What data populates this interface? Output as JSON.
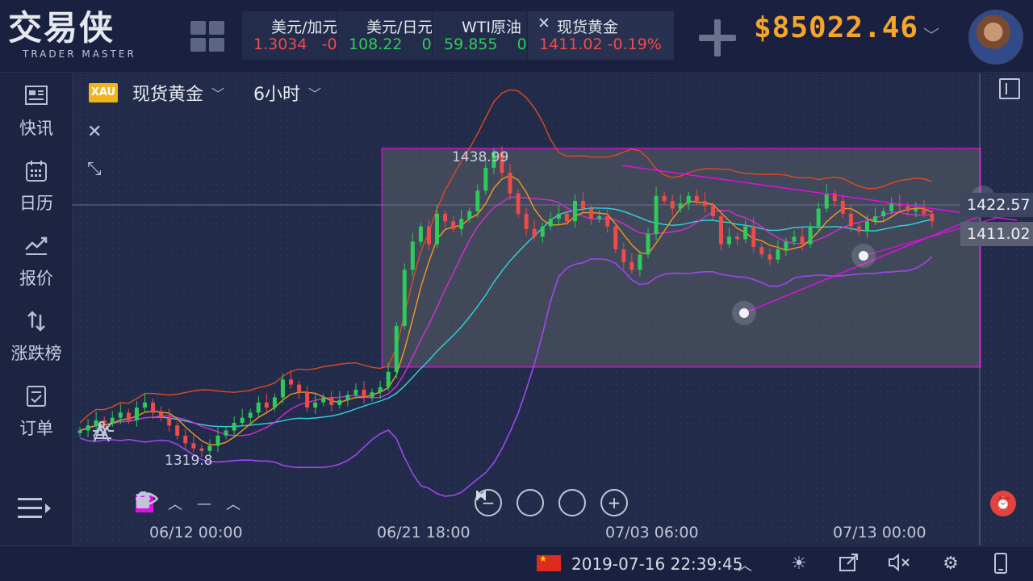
{
  "logo": {
    "cn": "交易侠",
    "en": "TRADER MASTER"
  },
  "tabs": [
    {
      "name": "美元/加元",
      "price": "1.3034",
      "change": "-0",
      "price_color": "red"
    },
    {
      "name": "美元/日元",
      "price": "108.22",
      "change": "0",
      "price_color": "green"
    },
    {
      "name": "WTI原油",
      "price": "59.855",
      "change": "0",
      "price_color": "green"
    },
    {
      "name": "现货黄金",
      "price": "1411.02",
      "change": "-0.19%",
      "price_color": "red",
      "active": true
    }
  ],
  "balance": "$85022.46",
  "sidebar": [
    {
      "label": "快讯",
      "icon": "news-icon"
    },
    {
      "label": "日历",
      "icon": "calendar-icon"
    },
    {
      "label": "报价",
      "icon": "quote-chart-icon"
    },
    {
      "label": "涨跌榜",
      "icon": "up-down-arrows-icon"
    },
    {
      "label": "订单",
      "icon": "order-icon"
    }
  ],
  "chart_header": {
    "badge": "XAU",
    "symbol": "现货黄金",
    "period": "6小时"
  },
  "price_tags": {
    "level": "1422.57",
    "current": "1411.02"
  },
  "labels": {
    "high": "1438.99",
    "low": "1319.8"
  },
  "x_axis": [
    "06/12 00:00",
    "06/21 18:00",
    "07/03 06:00",
    "07/13 00:00"
  ],
  "footer": {
    "datetime": "2019-07-16 22:39:45"
  },
  "colors": {
    "accent": "#f5a52a",
    "up": "#2fca5a",
    "down": "#ee4b4b",
    "drawing": "#e20ee2",
    "badge": "#f0b51e"
  },
  "chart_data": {
    "type": "candlestick",
    "symbol": "现货黄金",
    "period": "6小时",
    "x_ticks": [
      "06/12 00:00",
      "06/21 18:00",
      "07/03 06:00",
      "07/13 00:00"
    ],
    "high_marker": 1438.99,
    "low_marker": 1319.8,
    "current_price": 1411.02,
    "horizontal_level": 1422.57,
    "ylim": [
      1295,
      1450
    ],
    "closes": [
      1329,
      1331,
      1333,
      1332,
      1334,
      1336,
      1333,
      1338,
      1340,
      1336,
      1334,
      1331,
      1327,
      1324,
      1322,
      1321,
      1323,
      1327,
      1329,
      1332,
      1334,
      1336,
      1340,
      1338,
      1342,
      1349,
      1347,
      1344,
      1338,
      1340,
      1342,
      1339,
      1341,
      1343,
      1345,
      1342,
      1344,
      1346,
      1352,
      1370,
      1392,
      1403,
      1409,
      1402,
      1414,
      1411,
      1408,
      1412,
      1415,
      1423,
      1432,
      1438,
      1430,
      1422,
      1414,
      1408,
      1405,
      1409,
      1412,
      1414,
      1411,
      1419,
      1416,
      1412,
      1413,
      1409,
      1400,
      1395,
      1392,
      1398,
      1406,
      1421,
      1419,
      1416,
      1418,
      1421,
      1419,
      1417,
      1413,
      1402,
      1405,
      1404,
      1409,
      1401,
      1398,
      1396,
      1400,
      1403,
      1405,
      1402,
      1409,
      1416,
      1422,
      1419,
      1414,
      1409,
      1407,
      1411,
      1413,
      1415,
      1418,
      1417,
      1415,
      1416,
      1414,
      1411
    ]
  }
}
